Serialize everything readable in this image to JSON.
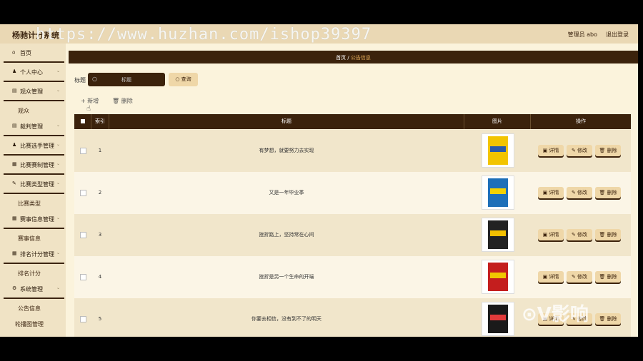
{
  "app": {
    "title": "杨驰计分系统",
    "watermark": "https://www.huzhan.com/ishop39397"
  },
  "topbar": {
    "admin": "管理员 abo",
    "logout": "退出登录"
  },
  "sidebar": {
    "items": [
      {
        "icon": "home-icon",
        "label": "首页",
        "chevron": false
      },
      {
        "icon": "user-icon",
        "label": "个人中心",
        "chevron": true
      },
      {
        "icon": "list-icon",
        "label": "观众管理",
        "chevron": true
      },
      {
        "sub": "观众"
      },
      {
        "icon": "list-icon",
        "label": "裁判管理",
        "chevron": true
      },
      {
        "icon": "user-icon",
        "label": "比赛选手管理",
        "chevron": true
      },
      {
        "icon": "grid-icon",
        "label": "比赛赛制管理",
        "chevron": true
      },
      {
        "icon": "tag-icon",
        "label": "比赛类型管理",
        "chevron": true
      },
      {
        "sub": "比赛类型"
      },
      {
        "icon": "grid-icon",
        "label": "赛事信息管理",
        "chevron": true
      },
      {
        "sub": "赛事信息"
      },
      {
        "icon": "grid-icon",
        "label": "排名计分管理",
        "chevron": true
      },
      {
        "sub": "排名计分"
      },
      {
        "icon": "gear-icon",
        "label": "系统管理",
        "chevron": true
      },
      {
        "sub": "公告信息"
      },
      {
        "sub": "轮播图管理"
      }
    ]
  },
  "breadcrumb": {
    "home": "首页",
    "sep": "/",
    "current": "公告信息"
  },
  "search": {
    "label": "标题",
    "placeholder": "标题",
    "button": "查询"
  },
  "actions": {
    "add": "新增",
    "delete": "删除"
  },
  "table": {
    "headers": [
      "索引",
      "标题",
      "图片",
      "操作"
    ],
    "rows": [
      {
        "index": "1",
        "title": "有梦想，就要努力去实现"
      },
      {
        "index": "2",
        "title": "又是一年毕业季"
      },
      {
        "index": "3",
        "title": "挫折路上，坚持常在心间"
      },
      {
        "index": "4",
        "title": "挫折是另一个生命的开端"
      },
      {
        "index": "5",
        "title": "你要去相信，没有到不了的明天"
      }
    ],
    "row_buttons": {
      "detail": "详情",
      "edit": "修改",
      "delete": "删除"
    }
  },
  "bottom_logo": "⊙V影响"
}
